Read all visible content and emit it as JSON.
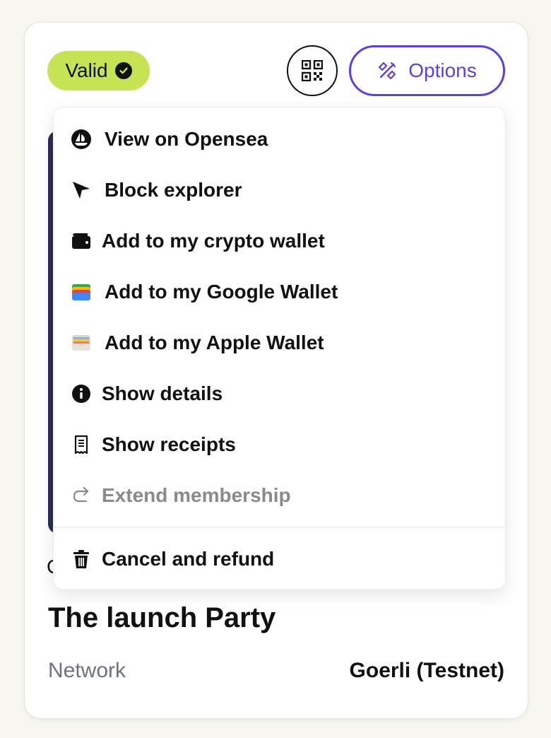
{
  "status_badge": {
    "label": "Valid"
  },
  "header": {
    "options_label": "Options"
  },
  "menu": {
    "items": [
      {
        "label": "View on Opensea",
        "icon": "opensea-icon",
        "disabled": false
      },
      {
        "label": "Block explorer",
        "icon": "cursor-arrow-icon",
        "disabled": false
      },
      {
        "label": "Add to my crypto wallet",
        "icon": "wallet-icon",
        "disabled": false
      },
      {
        "label": "Add to my Google Wallet",
        "icon": "google-wallet-icon",
        "disabled": false
      },
      {
        "label": "Add to my Apple Wallet",
        "icon": "apple-wallet-icon",
        "disabled": false
      },
      {
        "label": "Show details",
        "icon": "info-icon",
        "disabled": false
      },
      {
        "label": "Show receipts",
        "icon": "receipt-icon",
        "disabled": false
      },
      {
        "label": "Extend membership",
        "icon": "redo-arrow-icon",
        "disabled": true
      }
    ],
    "footer_item": {
      "label": "Cancel and refund",
      "icon": "trash-icon"
    }
  },
  "card": {
    "partial_text": "C",
    "title": "The launch Party",
    "network_label": "Network",
    "network_value": "Goerli (Testnet)"
  },
  "colors": {
    "badge": "#c5e353",
    "accent": "#603deb",
    "image_bg": "#2a2d52"
  }
}
